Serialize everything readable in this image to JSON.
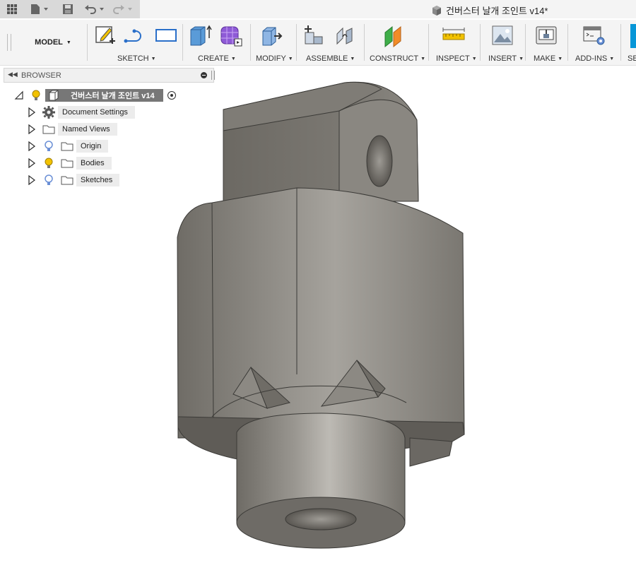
{
  "window": {
    "document_title": "건버스터 날개 조인트 v14*"
  },
  "toolbar": {
    "workspace": "MODEL",
    "groups": [
      {
        "label": "SKETCH"
      },
      {
        "label": "CREATE"
      },
      {
        "label": "MODIFY"
      },
      {
        "label": "ASSEMBLE"
      },
      {
        "label": "CONSTRUCT"
      },
      {
        "label": "INSPECT"
      },
      {
        "label": "INSERT"
      },
      {
        "label": "MAKE"
      },
      {
        "label": "ADD-INS"
      },
      {
        "label": "SE"
      }
    ]
  },
  "browser": {
    "title": "BROWSER",
    "root": {
      "label": "건버스터 날개 조인트 v14"
    },
    "items": [
      {
        "label": "Document Settings",
        "icon": "gear-icon"
      },
      {
        "label": "Named Views",
        "icon": "folder-icon"
      },
      {
        "label": "Origin",
        "icon": "folder-icon",
        "visibility": "off"
      },
      {
        "label": "Bodies",
        "icon": "folder-icon",
        "visibility": "on"
      },
      {
        "label": "Sketches",
        "icon": "folder-icon",
        "visibility": "off"
      }
    ]
  },
  "colors": {
    "accent": "#0696d7",
    "model": "#8a8780",
    "bulb_on": "#f2c200",
    "bulb_off": "#6a8fd6"
  }
}
